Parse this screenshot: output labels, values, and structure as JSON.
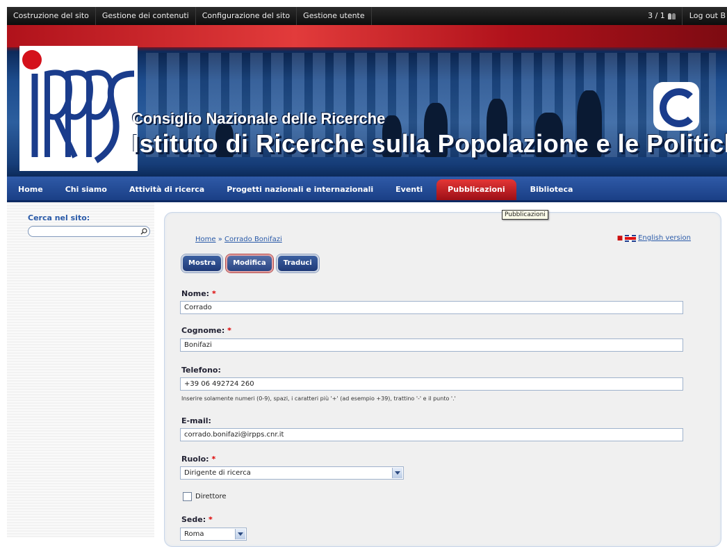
{
  "admin_bar": {
    "items": [
      "Costruzione del sito",
      "Gestione dei contenuti",
      "Configurazione del sito",
      "Gestione utente"
    ],
    "counter": "3 / 1",
    "logout": "Log out B"
  },
  "banner": {
    "cnr": "Consiglio Nazionale delle Ricerche",
    "institute": "Istituto di Ricerche sulla Popolazione e le Politiche Sociali"
  },
  "nav": {
    "tabs": [
      "Home",
      "Chi siamo",
      "Attività di ricerca",
      "Progetti nazionali e internazionali",
      "Eventi",
      "Pubblicazioni",
      "Biblioteca"
    ],
    "active": "Pubblicazioni"
  },
  "tooltip": "Pubblicazioni",
  "sidebar": {
    "search_label": "Cerca nel sito:",
    "search_value": ""
  },
  "breadcrumb": {
    "home": "Home",
    "separator": "»",
    "current": "Corrado Bonifazi"
  },
  "language_link": "English version",
  "action_tabs": [
    "Mostra",
    "Modifica",
    "Traduci"
  ],
  "form": {
    "nome_label": "Nome:",
    "nome_value": "Corrado",
    "cognome_label": "Cognome:",
    "cognome_value": "Bonifazi",
    "telefono_label": "Telefono:",
    "telefono_value": "+39 06 492724 260",
    "telefono_hint": "Inserire solamente numeri (0-9), spazi, i caratteri più '+' (ad esempio +39), trattino '-' e il punto '.'",
    "email_label": "E-mail:",
    "email_value": "corrado.bonifazi@irpps.cnr.it",
    "ruolo_label": "Ruolo:",
    "ruolo_value": "Dirigente di ricerca",
    "direttore_label": "Direttore",
    "sede_label": "Sede:",
    "sede_value": "Roma",
    "required_mark": "*"
  },
  "colors": {
    "nav_blue": "#1f4a96",
    "accent_red": "#c8141d",
    "link": "#2a5aa8"
  }
}
